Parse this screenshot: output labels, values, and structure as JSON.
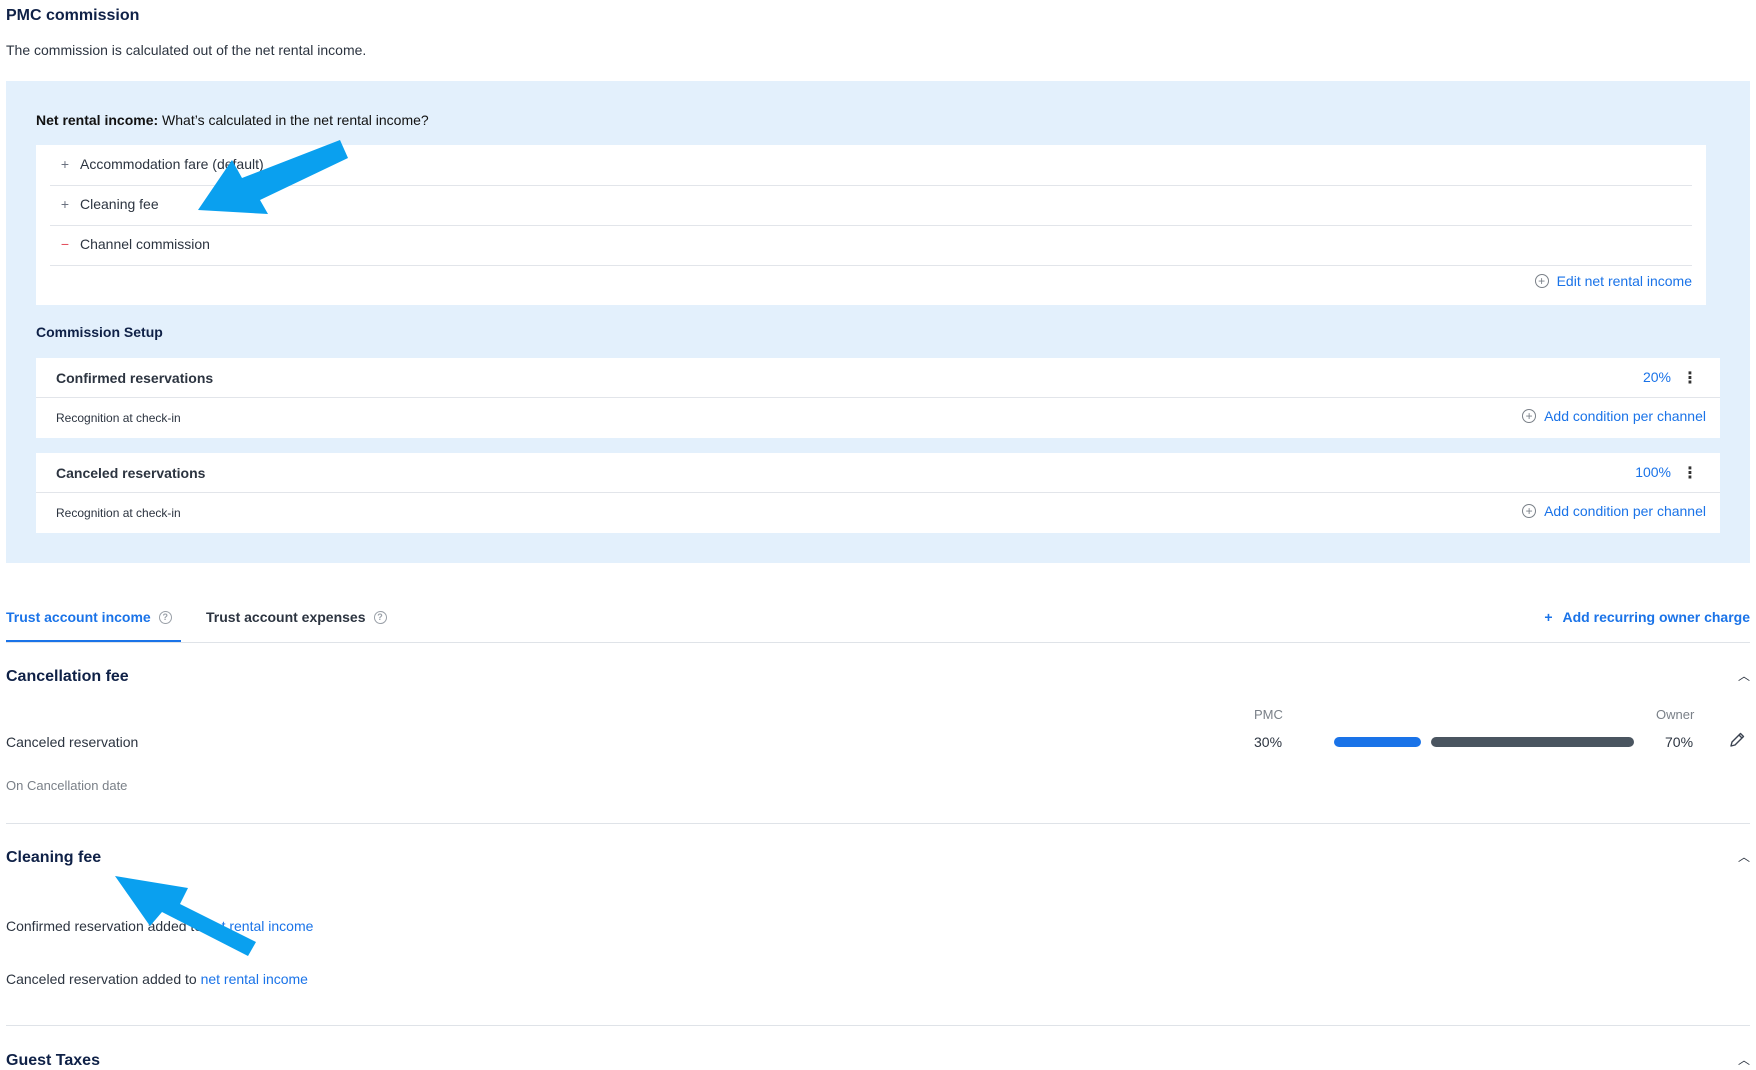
{
  "pmc": {
    "title": "PMC commission",
    "subtitle": "The commission is calculated out of the net rental income."
  },
  "net_rental_income": {
    "label": "Net rental income:",
    "question": "What’s calculated in the net rental income?",
    "items": [
      {
        "sign": "+",
        "label": "Accommodation fare (default)"
      },
      {
        "sign": "+",
        "label": "Cleaning fee"
      },
      {
        "sign": "−",
        "label": "Channel commission"
      }
    ],
    "edit_label": "Edit net rental income"
  },
  "commission_setup": {
    "title": "Commission Setup",
    "cards": [
      {
        "name": "Confirmed reservations",
        "percent": "20%",
        "recognition": "Recognition at check-in",
        "add_condition": "Add condition per channel"
      },
      {
        "name": "Canceled reservations",
        "percent": "100%",
        "recognition": "Recognition at check-in",
        "add_condition": "Add condition per channel"
      }
    ]
  },
  "tabs": {
    "income": "Trust account income",
    "expenses": "Trust account expenses",
    "add_recurring": "Add recurring owner charge"
  },
  "cancellation_fee": {
    "title": "Cancellation fee",
    "row_label": "Canceled reservation",
    "pmc_header": "PMC",
    "owner_header": "Owner",
    "pmc_value": "30%",
    "owner_value": "70%",
    "pmc_share": 0.3,
    "timing": "On Cancellation date"
  },
  "cleaning_fee": {
    "title": "Cleaning fee",
    "rows": [
      {
        "text": "Confirmed reservation added to",
        "link": "net rental income"
      },
      {
        "text": "Canceled reservation added to",
        "link": "net rental income"
      }
    ]
  },
  "guest_taxes": {
    "title": "Guest Taxes"
  },
  "colors": {
    "accent": "#1a73e8",
    "panel_bg": "#e3f0fc",
    "owner_bar": "#4a5560",
    "annotation_arrow": "#0aa0ef"
  }
}
